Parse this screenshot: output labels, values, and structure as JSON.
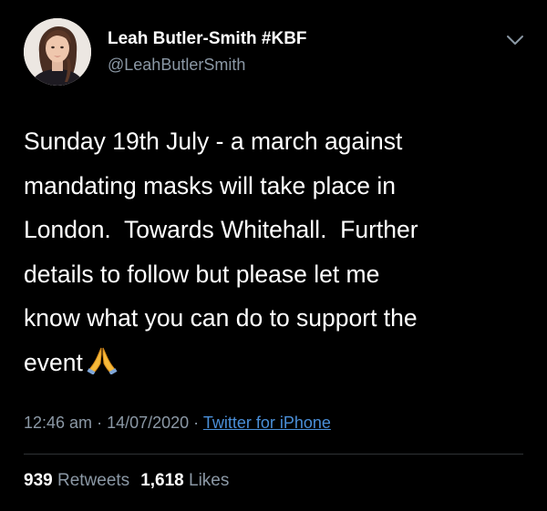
{
  "author": {
    "display_name": "Leah Butler-Smith #KBF",
    "handle": "@LeahButlerSmith",
    "avatar_icon": "profile-photo"
  },
  "menu": {
    "icon": "chevron-down-icon"
  },
  "tweet": {
    "text": "Sunday 19th July - a march against\nmandating masks will take place in\nLondon.  Towards Whitehall.  Further\ndetails to follow but please let me\nknow what you can do to support the\nevent",
    "emoji": "folded-hands-icon"
  },
  "meta": {
    "time": "12:46 am",
    "sep1": " · ",
    "date": "14/07/2020",
    "sep2": " · ",
    "source": "Twitter for iPhone"
  },
  "stats": {
    "retweets_count": "939",
    "retweets_label": "Retweets",
    "likes_count": "1,618",
    "likes_label": "Likes"
  },
  "colors": {
    "background": "#000000",
    "text": "#ffffff",
    "secondary": "#8b98a5",
    "link": "#4a8fd8",
    "divider": "#2f3336"
  }
}
